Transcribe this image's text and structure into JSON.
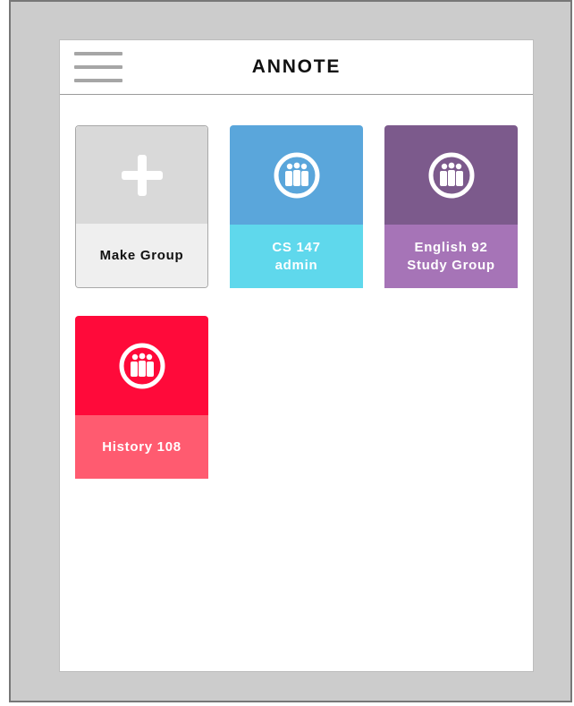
{
  "app": {
    "title": "ANNOTE"
  },
  "icons": {
    "menu": "hamburger-menu-icon",
    "make_group": "plus-icon",
    "group": "group-icon"
  },
  "colors": {
    "frame": "#cccccc",
    "frame_border": "#777777",
    "screen": "#ffffff",
    "make_top": "#d9d9d9",
    "make_bottom": "#efefef"
  },
  "groups": [
    {
      "label": "Make Group",
      "top_color": "#d9d9d9",
      "bottom_color": "#efefef"
    },
    {
      "label": "CS 147\nadmin",
      "top_color": "#5aa6db",
      "bottom_color": "#5fd8ec"
    },
    {
      "label": "English 92\nStudy Group",
      "top_color": "#7c5a8c",
      "bottom_color": "#a674b7"
    },
    {
      "label": "History 108",
      "top_color": "#ff0a3a",
      "bottom_color": "#ff5b70"
    }
  ]
}
